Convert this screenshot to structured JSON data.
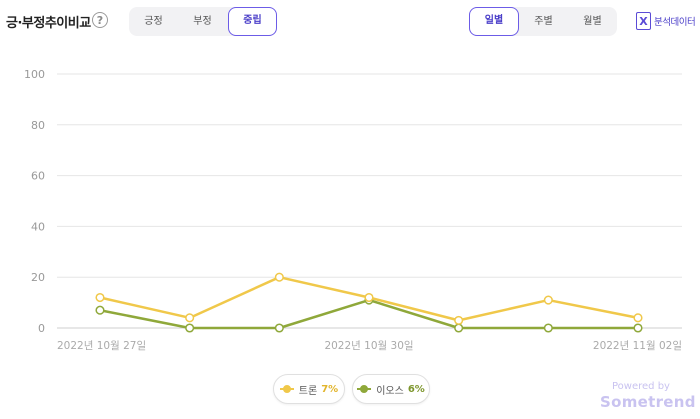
{
  "header": {
    "title": "긍·부정추이비교",
    "help_glyph": "?",
    "sentiment_tabs": [
      {
        "label": "긍정",
        "active": false
      },
      {
        "label": "부정",
        "active": false
      },
      {
        "label": "중립",
        "active": true
      }
    ],
    "period_tabs": [
      {
        "label": "일별",
        "active": true
      },
      {
        "label": "주별",
        "active": false
      },
      {
        "label": "월별",
        "active": false
      }
    ],
    "export_label": "분석데이터",
    "export_icon": "excel-icon",
    "export_glyph": "X"
  },
  "chart_data": {
    "type": "line",
    "x": [
      "2022-10-27",
      "2022-10-28",
      "2022-10-29",
      "2022-10-30",
      "2022-10-31",
      "2022-11-01",
      "2022-11-02"
    ],
    "x_tick_labels": [
      {
        "index": 0,
        "label": "2022년 10월 27일"
      },
      {
        "index": 3,
        "label": "2022년 10월 30일"
      },
      {
        "index": 6,
        "label": "2022년 11월 02일"
      }
    ],
    "series": [
      {
        "name": "트론",
        "share": "7%",
        "color": "#f0c84a",
        "values": [
          12,
          4,
          20,
          12,
          3,
          11,
          4
        ]
      },
      {
        "name": "이오스",
        "share": "6%",
        "color": "#8fa83a",
        "values": [
          7,
          0,
          0,
          11,
          0,
          0,
          0
        ]
      }
    ],
    "ylim": [
      0,
      100
    ],
    "y_ticks": [
      0,
      20,
      40,
      60,
      80,
      100
    ],
    "grid": true,
    "legend": "bottom-center"
  },
  "footer": {
    "powered_by": "Powered by",
    "brand": "Sometrend"
  },
  "colors": {
    "accent": "#6c5ce7",
    "grid": "#e6e6e6",
    "axis_text": "#999999"
  }
}
